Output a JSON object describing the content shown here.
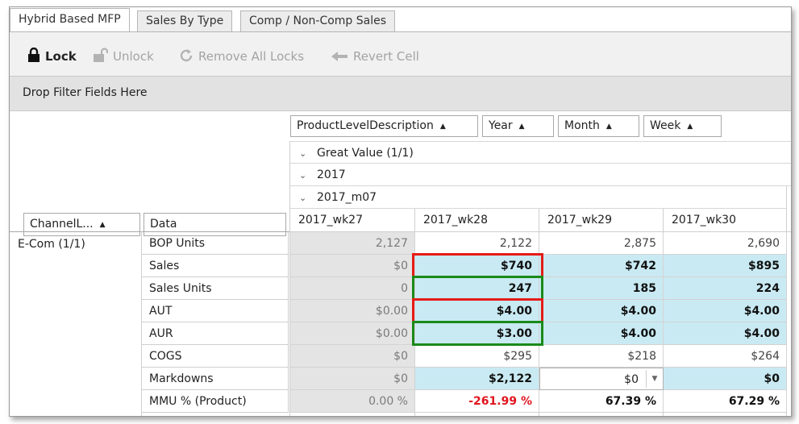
{
  "tabs": [
    {
      "label": "Hybrid Based MFP",
      "active": true
    },
    {
      "label": "Sales By Type",
      "active": false
    },
    {
      "label": "Comp / Non-Comp Sales",
      "active": false
    }
  ],
  "toolbar": {
    "lock": "Lock",
    "unlock": "Unlock",
    "remove_all_locks": "Remove All Locks",
    "revert_cell": "Revert Cell"
  },
  "filter_area": {
    "placeholder": "Drop Filter Fields Here"
  },
  "column_fields": [
    "ProductLevelDescription",
    "Year",
    "Month",
    "Week"
  ],
  "column_groups": {
    "product": "Great Value (1/1)",
    "year": "2017",
    "month": "2017_m07"
  },
  "row_fields": {
    "channel": "ChannelL...",
    "data": "Data"
  },
  "channel_value": "E-Com (1/1)",
  "weeks": [
    "2017_wk27",
    "2017_wk28",
    "2017_wk29",
    "2017_wk30"
  ],
  "rows": [
    {
      "label": "BOP Units",
      "values": [
        "2,127",
        "2,122",
        "2,875",
        "2,690"
      ]
    },
    {
      "label": "Sales",
      "values": [
        "$0",
        "$740",
        "$742",
        "$895"
      ]
    },
    {
      "label": "Sales Units",
      "values": [
        "0",
        "247",
        "185",
        "224"
      ]
    },
    {
      "label": "AUT",
      "values": [
        "$0.00",
        "$4.00",
        "$4.00",
        "$4.00"
      ]
    },
    {
      "label": "AUR",
      "values": [
        "$0.00",
        "$3.00",
        "$4.00",
        "$4.00"
      ]
    },
    {
      "label": "COGS",
      "values": [
        "$0",
        "$295",
        "$218",
        "$264"
      ]
    },
    {
      "label": "Markdowns",
      "values": [
        "$0",
        "$2,122",
        "$0",
        "$0"
      ]
    },
    {
      "label": "MMU % (Product)",
      "values": [
        "0.00 %",
        "-261.99 %",
        "67.39 %",
        "67.29 %"
      ]
    }
  ],
  "colors": {
    "highlight_red": "#e51b17",
    "highlight_green": "#1a8a1a",
    "editable_blue": "#c9eaf3",
    "negative_red": "#e0141e"
  }
}
